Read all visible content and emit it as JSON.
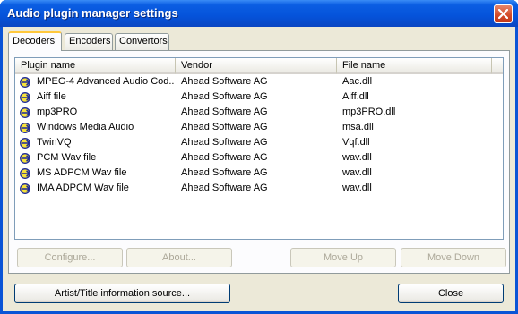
{
  "window": {
    "title": "Audio plugin manager settings"
  },
  "tabs": [
    {
      "label": "Decoders",
      "active": true
    },
    {
      "label": "Encoders",
      "active": false
    },
    {
      "label": "Convertors",
      "active": false
    }
  ],
  "list": {
    "columns": [
      "Plugin name",
      "Vendor",
      "File name"
    ],
    "rows": [
      {
        "name": "MPEG-4 Advanced Audio Cod...",
        "vendor": "Ahead Software AG",
        "file": "Aac.dll"
      },
      {
        "name": "Aiff file",
        "vendor": "Ahead Software AG",
        "file": "Aiff.dll"
      },
      {
        "name": "mp3PRO",
        "vendor": "Ahead Software AG",
        "file": "mp3PRO.dll"
      },
      {
        "name": "Windows Media Audio",
        "vendor": "Ahead Software AG",
        "file": "msa.dll"
      },
      {
        "name": "TwinVQ",
        "vendor": "Ahead Software AG",
        "file": "Vqf.dll"
      },
      {
        "name": "PCM Wav file",
        "vendor": "Ahead Software AG",
        "file": "wav.dll"
      },
      {
        "name": "MS ADPCM Wav file",
        "vendor": "Ahead Software AG",
        "file": "wav.dll"
      },
      {
        "name": "IMA ADPCM Wav file",
        "vendor": "Ahead Software AG",
        "file": "wav.dll"
      }
    ],
    "row_icon": "plugin-arrow-icon"
  },
  "buttons": {
    "configure": "Configure...",
    "about": "About...",
    "move_up": "Move Up",
    "move_down": "Move Down",
    "artist_title": "Artist/Title information source...",
    "close": "Close"
  },
  "colors": {
    "titlebar": "#0553da",
    "dialog_bg": "#ece9d8",
    "active_tab_accent": "#ffc83c"
  }
}
